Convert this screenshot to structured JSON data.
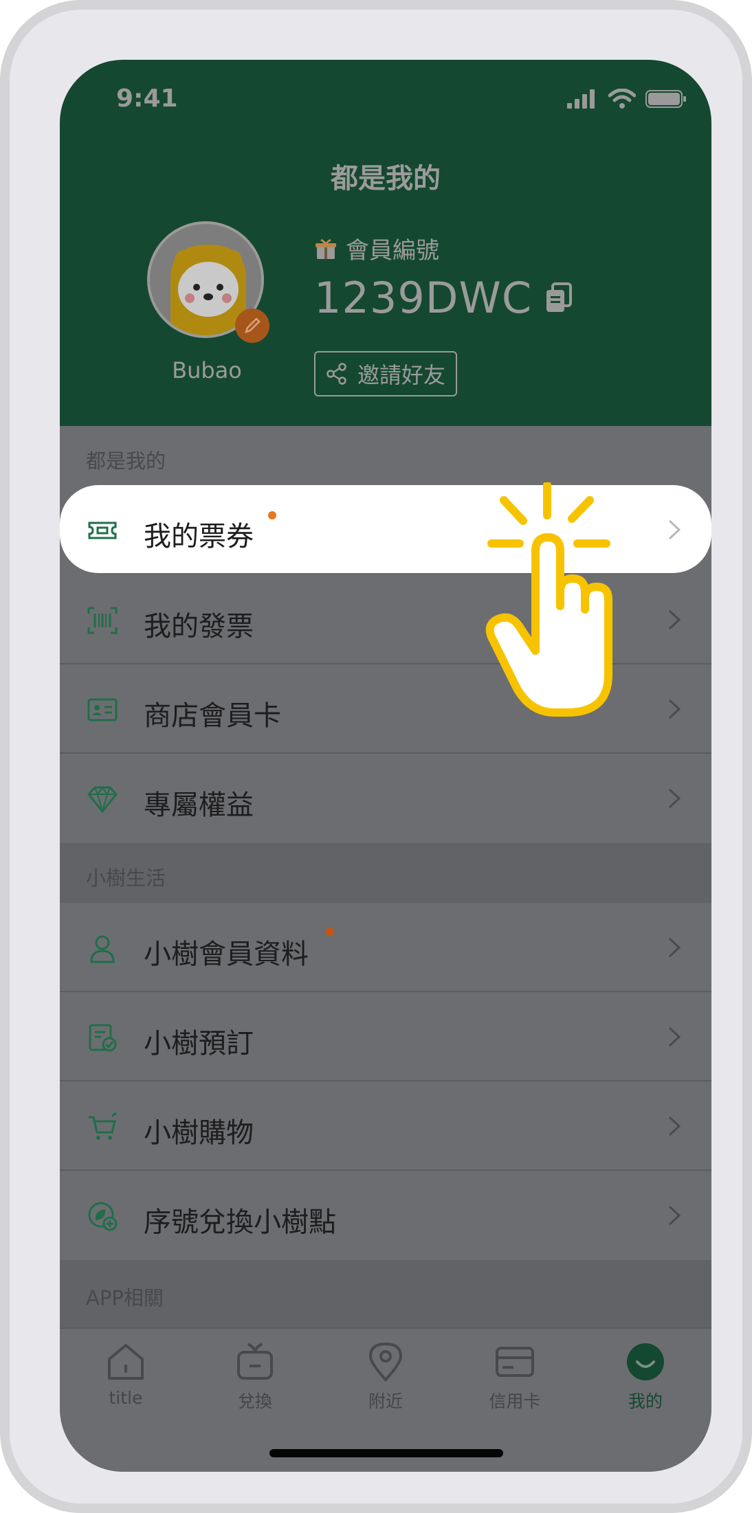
{
  "status": {
    "time": "9:41"
  },
  "header": {
    "title": "都是我的",
    "username": "Bubao",
    "member_label": "會員編號",
    "member_id": "1239DWC",
    "invite_label": "邀請好友"
  },
  "sections": [
    {
      "label": "都是我的",
      "items": [
        {
          "label": "我的票券",
          "icon": "ticket-icon",
          "dot": true,
          "highlighted": true
        },
        {
          "label": "我的發票",
          "icon": "barcode-icon",
          "dot": false
        },
        {
          "label": "商店會員卡",
          "icon": "member-card-icon",
          "dot": false
        },
        {
          "label": "專屬權益",
          "icon": "diamond-icon",
          "dot": false
        }
      ]
    },
    {
      "label": "小樹生活",
      "items": [
        {
          "label": "小樹會員資料",
          "icon": "person-icon",
          "dot": true
        },
        {
          "label": "小樹預訂",
          "icon": "clipboard-check-icon",
          "dot": false
        },
        {
          "label": "小樹購物",
          "icon": "cart-icon",
          "dot": false
        },
        {
          "label": "序號兌換小樹點",
          "icon": "leaf-plus-icon",
          "dot": false
        }
      ]
    },
    {
      "label": "APP相關",
      "items": []
    }
  ],
  "tabs": [
    {
      "label": "title",
      "icon": "home-icon",
      "active": false
    },
    {
      "label": "兌換",
      "icon": "gift-icon",
      "active": false
    },
    {
      "label": "附近",
      "icon": "location-pin-icon",
      "active": false
    },
    {
      "label": "信用卡",
      "icon": "credit-card-icon",
      "active": false
    },
    {
      "label": "我的",
      "icon": "smile-icon",
      "active": true
    }
  ],
  "colors": {
    "header_bg": "#154830",
    "accent_green": "#1f6e4a",
    "dot_orange": "#e8771f",
    "hand_yellow": "#f7c300"
  }
}
